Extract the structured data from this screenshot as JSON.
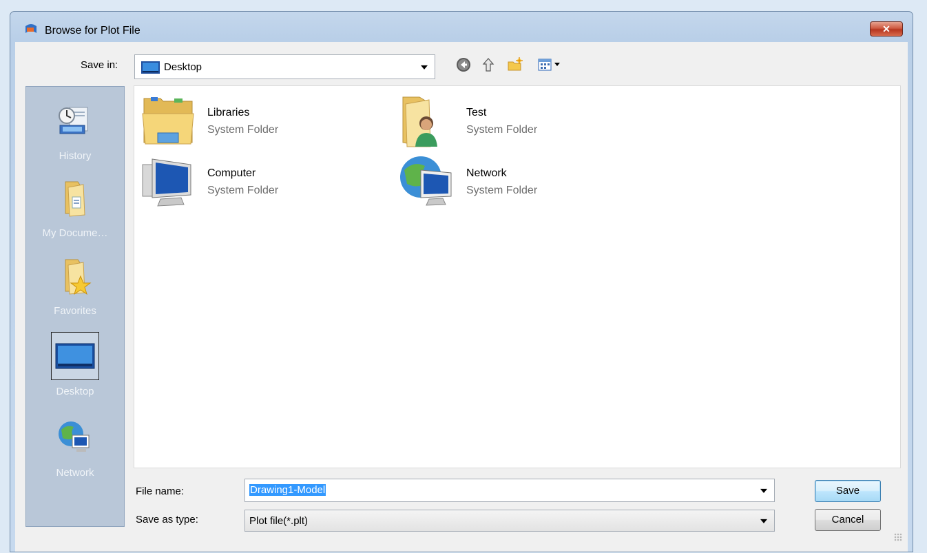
{
  "dialog": {
    "title": "Browse for Plot File",
    "close_label": "✕"
  },
  "save_in": {
    "label": "Save in:",
    "value": "Desktop"
  },
  "toolbar": {
    "icons": [
      "back-icon",
      "up-folder-icon",
      "new-folder-icon",
      "views-menu-icon"
    ]
  },
  "places": [
    {
      "label": "History",
      "icon": "history-icon"
    },
    {
      "label": "My Docume…",
      "icon": "my-documents-icon"
    },
    {
      "label": "Favorites",
      "icon": "favorites-icon"
    },
    {
      "label": "Desktop",
      "icon": "desktop-icon",
      "selected": true
    },
    {
      "label": "Network",
      "icon": "network-icon"
    }
  ],
  "files": [
    {
      "name": "Libraries",
      "type": "System Folder",
      "icon": "libraries-icon"
    },
    {
      "name": "Test",
      "type": "System Folder",
      "icon": "user-folder-icon"
    },
    {
      "name": "Computer",
      "type": "System Folder",
      "icon": "computer-icon"
    },
    {
      "name": "Network",
      "type": "System Folder",
      "icon": "network-icon"
    }
  ],
  "file_name": {
    "label": "File name:",
    "value": "Drawing1-Model"
  },
  "save_as_type": {
    "label": "Save as type:",
    "value": "Plot file(*.plt)"
  },
  "buttons": {
    "save": "Save",
    "cancel": "Cancel"
  }
}
